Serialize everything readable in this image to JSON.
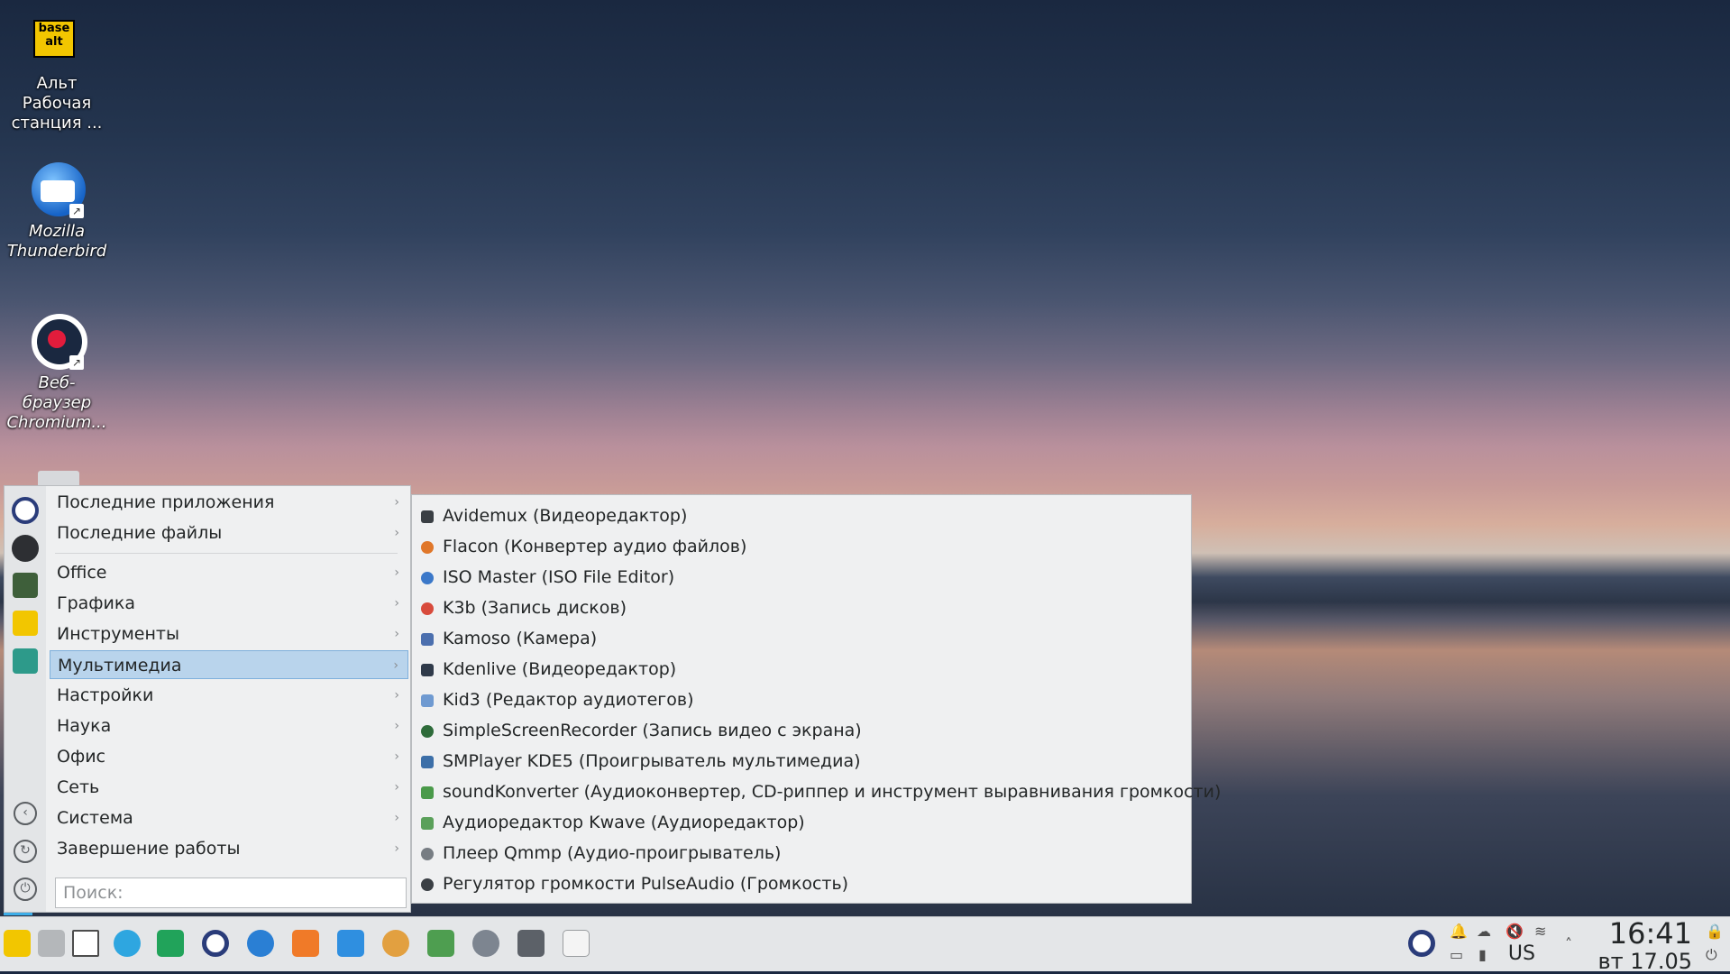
{
  "desktop": {
    "icons": [
      {
        "label": "Альт\nРабочая\nстанция ..."
      },
      {
        "label": "Mozilla\nThunderbird"
      },
      {
        "label": "Веб-\nбраузер\nChromium..."
      }
    ],
    "alt_logo_text": "base alt"
  },
  "menu": {
    "items": [
      {
        "label": "Последние приложения"
      },
      {
        "label": "Последние файлы"
      },
      {
        "label": "Office"
      },
      {
        "label": "Графика"
      },
      {
        "label": "Инструменты"
      },
      {
        "label": "Мультимедиа"
      },
      {
        "label": "Настройки"
      },
      {
        "label": "Наука"
      },
      {
        "label": "Офис"
      },
      {
        "label": "Сеть"
      },
      {
        "label": "Система"
      },
      {
        "label": "Завершение работы"
      }
    ],
    "arrow": "›",
    "search_placeholder": "Поиск:"
  },
  "submenu": {
    "items": [
      {
        "label": "Avidemux (Видеоредактор)",
        "color": "#3a3f44"
      },
      {
        "label": "Flacon (Конвертер аудио файлов)",
        "color": "#e0772a"
      },
      {
        "label": "ISO Master (ISO File Editor)",
        "color": "#3b78c9"
      },
      {
        "label": "K3b (Запись дисков)",
        "color": "#d84b3c"
      },
      {
        "label": "Kamoso (Камера)",
        "color": "#4b6fae"
      },
      {
        "label": "Kdenlive (Видеоредактор)",
        "color": "#2f3a4a"
      },
      {
        "label": "Kid3 (Редактор аудиотегов)",
        "color": "#6f9ad1"
      },
      {
        "label": "SimpleScreenRecorder (Запись видео с экрана)",
        "color": "#2e6b3a"
      },
      {
        "label": "SMPlayer KDE5 (Проигрыватель мультимедиа)",
        "color": "#3c6fa8"
      },
      {
        "label": "soundKonverter (Аудиоконвертер, CD-риппер и инструмент выравнивания громкости)",
        "color": "#4a9a4a"
      },
      {
        "label": "Аудиоредактор Kwave (Аудиоредактор)",
        "color": "#5aa05a"
      },
      {
        "label": "Плеер Qmmp (Аудио-проигрыватель)",
        "color": "#777d83"
      },
      {
        "label": "Регулятор громкости PulseAudio (Громкость)",
        "color": "#3a3f44"
      }
    ]
  },
  "taskbar": {
    "keyboard_layout": "US",
    "time": "16:41",
    "date": "вт 17.05"
  }
}
